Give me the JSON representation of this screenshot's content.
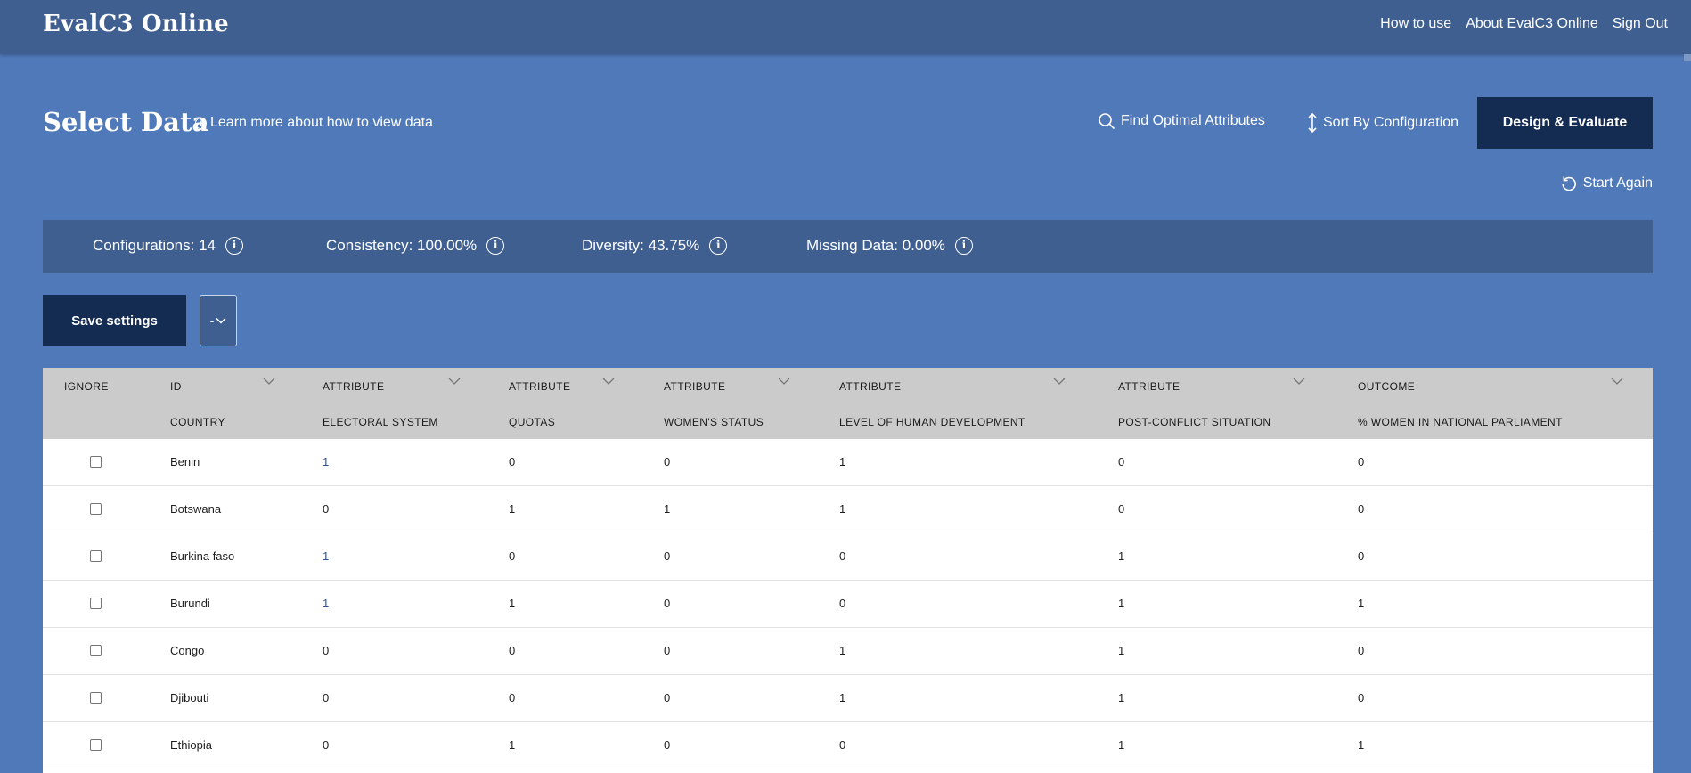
{
  "app": {
    "brand": "EvalC3 Online"
  },
  "nav": {
    "how_to_use": "How to use",
    "about": "About EvalC3 Online",
    "sign_out": "Sign Out"
  },
  "page": {
    "title": "Select Data",
    "learn_more": "Learn more about how to view data",
    "find_optimal": "Find Optimal Attributes",
    "sort_by": "Sort By Configuration",
    "design_evaluate": "Design & Evaluate",
    "start_again": "Start Again"
  },
  "stats": {
    "configurations": "Configurations: 14",
    "consistency": "Consistency: 100.00%",
    "diversity": "Diversity: 43.75%",
    "missing": "Missing Data: 0.00%"
  },
  "controls": {
    "save_settings": "Save settings",
    "dropdown_value": "-"
  },
  "table": {
    "columns": [
      {
        "role": "IGNORE",
        "name": ""
      },
      {
        "role": "ID",
        "name": "COUNTRY"
      },
      {
        "role": "ATTRIBUTE",
        "name": "ELECTORAL SYSTEM"
      },
      {
        "role": "ATTRIBUTE",
        "name": "QUOTAS"
      },
      {
        "role": "ATTRIBUTE",
        "name": "WOMEN'S STATUS"
      },
      {
        "role": "ATTRIBUTE",
        "name": "LEVEL OF HUMAN DEVELOPMENT"
      },
      {
        "role": "ATTRIBUTE",
        "name": "POST-CONFLICT SITUATION"
      },
      {
        "role": "OUTCOME",
        "name": "% WOMEN IN NATIONAL PARLIAMENT"
      }
    ],
    "rows": [
      {
        "country": "Benin",
        "values": [
          "1",
          "0",
          "0",
          "1",
          "0",
          "0"
        ]
      },
      {
        "country": "Botswana",
        "values": [
          "0",
          "1",
          "1",
          "1",
          "0",
          "0"
        ]
      },
      {
        "country": "Burkina faso",
        "values": [
          "1",
          "0",
          "0",
          "0",
          "1",
          "0"
        ]
      },
      {
        "country": "Burundi",
        "values": [
          "1",
          "1",
          "0",
          "0",
          "1",
          "1"
        ]
      },
      {
        "country": "Congo",
        "values": [
          "0",
          "0",
          "0",
          "1",
          "1",
          "0"
        ]
      },
      {
        "country": "Djibouti",
        "values": [
          "0",
          "0",
          "0",
          "1",
          "1",
          "0"
        ]
      },
      {
        "country": "Ethiopia",
        "values": [
          "0",
          "1",
          "0",
          "0",
          "1",
          "1"
        ]
      }
    ]
  },
  "colors": {
    "background": "#5079b9",
    "topbar": "#3f5f91",
    "dark_button": "#142b52",
    "table_header": "#cbcbcb",
    "link_value": "#2456a7"
  },
  "icons": {
    "info": "info-circle-icon",
    "search": "search-icon",
    "sort": "vertical-arrows-icon",
    "restart": "restart-icon",
    "chevron": "chevron-down-icon"
  }
}
